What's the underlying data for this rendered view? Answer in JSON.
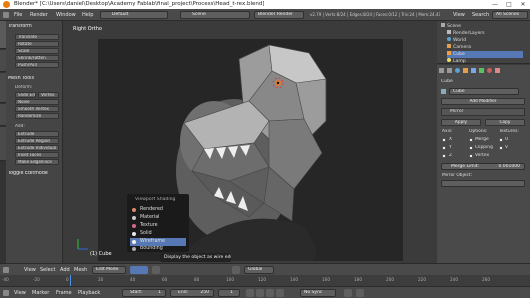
{
  "window": {
    "title": "Blender* [C:\\Users\\daniel\\Desktop\\Academy Fablab\\final_project\\Process\\Head_t-rex.blend]",
    "minimize": "—",
    "maximize": "□",
    "close": "✕"
  },
  "header": {
    "menus": [
      "File",
      "Render",
      "Window",
      "Help"
    ],
    "layout": "Default",
    "scene": "Scene",
    "engine": "Blender Render",
    "stats": "v2.79 | Verts:8/24 | Edges:8/24 | Faces:0/12 | Tris:24 | Mem:24.47M | Cube",
    "outliner_view": "View",
    "outliner_search": "Search",
    "outliner_scenes": "All Scenes"
  },
  "toolshelf": {
    "tabs": [
      "Tools",
      "Create",
      "Shading/UVs",
      "Options",
      "Grease Pencil"
    ],
    "transform_header": "Transform",
    "transform_buttons": [
      "Translate",
      "Rotate",
      "Scale",
      "Shrink/Fatten",
      "Push/Pull"
    ],
    "mesh_tools_header": "Mesh Tools",
    "deform_label": "Deform:",
    "deform_buttons_row": [
      "Slide Ed",
      "Vertex"
    ],
    "deform_buttons": [
      "Noise",
      "Smooth Vertex",
      "Randomize"
    ],
    "add_label": "Add:",
    "add_buttons": [
      "Extrude",
      "Extrude Region",
      "Extrude Individual",
      "Inset Faces",
      "Make Edge/Face"
    ],
    "toggle_header": "Toggle Editmode"
  },
  "viewport": {
    "label": "Right Ortho",
    "object_label": "(1) Cube",
    "shading_menu": {
      "title": "Viewport Shading",
      "items": [
        {
          "label": "Rendered",
          "color": "#d88a6a"
        },
        {
          "label": "Material",
          "color": "#c8c8c8"
        },
        {
          "label": "Texture",
          "color": "#d26a8c"
        },
        {
          "label": "Solid",
          "color": "#e8e8e8"
        },
        {
          "label": "Wireframe",
          "color": "#f0f0f0"
        },
        {
          "label": "Bounding",
          "color": "#aaaaaa"
        }
      ],
      "highlight": "#5679b6"
    },
    "tooltip": "Display the object as wire edges"
  },
  "viewport_header": {
    "items": [
      "View",
      "Select",
      "Add",
      "Mesh"
    ],
    "mode": "Edit Mode",
    "global": "Global"
  },
  "outliner": {
    "items": [
      "Scene",
      "RenderLayers",
      "World",
      "Camera",
      "Cube",
      "Lamp"
    ]
  },
  "properties": {
    "object": "Cube",
    "add_modifier": "Add Modifier",
    "modifier": "Mirror",
    "apply": "Apply",
    "copy": "Copy",
    "axis_label": "Axis:",
    "options_label": "Options:",
    "textures_label": "Textures:",
    "axes": [
      "X",
      "Y",
      "Z"
    ],
    "options": [
      "Merge",
      "Clipping",
      "Vertex"
    ],
    "textures": [
      "U",
      "V"
    ],
    "merge_limit_label": "Merge Limit:",
    "merge_limit_value": "0.001000",
    "mirror_object": "Mirror Object:"
  },
  "timeline": {
    "ruler": [
      "-40",
      "-20",
      "0",
      "20",
      "40",
      "60",
      "80",
      "100",
      "120",
      "140",
      "160",
      "180",
      "200",
      "220",
      "240",
      "260"
    ],
    "menus": [
      "View",
      "Marker",
      "Frame",
      "Playback"
    ],
    "start": "Start:",
    "start_value": "1",
    "end": "End:",
    "end_value": "250",
    "current": "1",
    "sync": "No Sync"
  }
}
